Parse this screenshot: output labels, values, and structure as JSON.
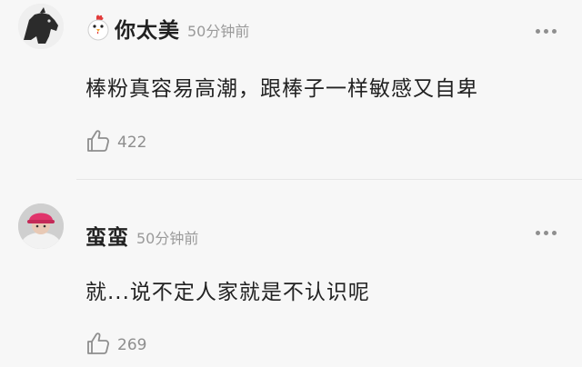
{
  "comments": [
    {
      "username": "你太美",
      "time": "50分钟前",
      "text": "棒粉真容易高潮，跟棒子一样敏感又自卑",
      "likes": "422",
      "avatar_icon": "horse-avatar",
      "badge_icon": "chicken-icon"
    },
    {
      "username": "蛮蛮",
      "time": "50分钟前",
      "text": "就...说不定人家就是不认识呢",
      "likes": "269",
      "avatar_icon": "person-photo-avatar"
    }
  ],
  "colors": {
    "background": "#f7f7f7",
    "text": "#222222",
    "muted": "#9a9a9a",
    "divider": "#e6e6e6"
  }
}
